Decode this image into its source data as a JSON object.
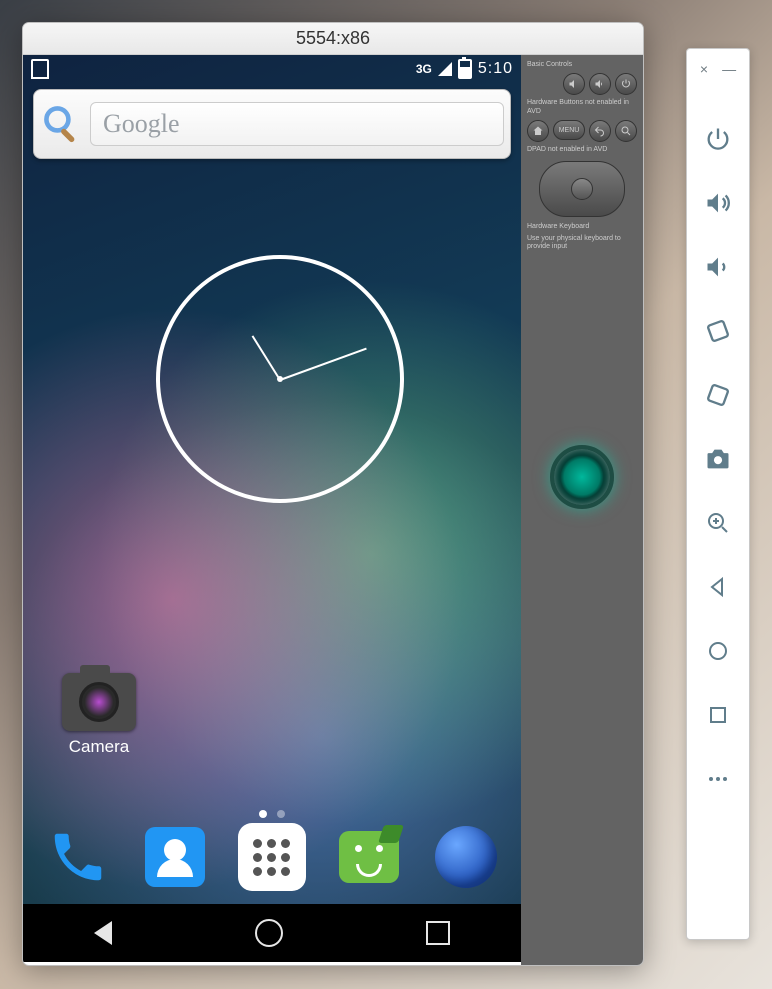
{
  "titlebar": {
    "title": "5554:x86"
  },
  "statusbar": {
    "network": "3G",
    "time": "5:10"
  },
  "search": {
    "placeholder": "Google"
  },
  "apps": {
    "camera_label": "Camera"
  },
  "skin": {
    "basic_label": "Basic Controls",
    "hardware_buttons_label": "Hardware Buttons not enabled in AVD",
    "dpad_label": "DPAD not enabled in AVD",
    "menu_label": "MENU",
    "keyboard_label": "Hardware Keyboard",
    "keyboard_hint": "Use your physical keyboard to provide input"
  },
  "toolbar": {
    "close": "×",
    "minimize": "—"
  }
}
